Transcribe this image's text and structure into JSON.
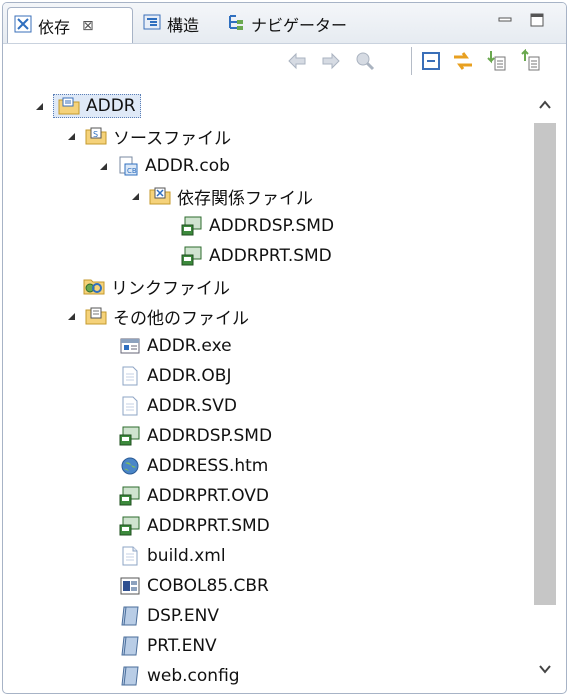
{
  "tabs": [
    {
      "label": "依存",
      "icon": "dependency-view-icon",
      "active": true
    },
    {
      "label": "構造",
      "icon": "structure-view-icon",
      "active": false
    },
    {
      "label": "ナビゲーター",
      "icon": "navigator-view-icon",
      "active": false
    }
  ],
  "close_glyph": "⊠",
  "toolbar": [
    "back-arrow-icon",
    "forward-arrow-icon",
    "up-folder-icon",
    "collapse-all-icon",
    "link-with-editor-icon",
    "dependency-in-icon",
    "dependency-out-icon"
  ],
  "tree": {
    "root": {
      "label": "ADDR"
    },
    "source_files": {
      "label": "ソースファイル"
    },
    "addr_cob": {
      "label": "ADDR.cob"
    },
    "dependency_files": {
      "label": "依存関係ファイル"
    },
    "dep_addrdsp": {
      "label": "ADDRDSP.SMD"
    },
    "dep_addrprt": {
      "label": "ADDRPRT.SMD"
    },
    "link_files": {
      "label": "リンクファイル"
    },
    "other_files": {
      "label": "その他のファイル"
    },
    "others": [
      {
        "label": "ADDR.exe",
        "icon": "executable-icon"
      },
      {
        "label": "ADDR.OBJ",
        "icon": "file-icon"
      },
      {
        "label": "ADDR.SVD",
        "icon": "file-icon"
      },
      {
        "label": "ADDRDSP.SMD",
        "icon": "screen-definition-icon"
      },
      {
        "label": "ADDRESS.htm",
        "icon": "web-page-icon"
      },
      {
        "label": "ADDRPRT.OVD",
        "icon": "screen-definition-icon"
      },
      {
        "label": "ADDRPRT.SMD",
        "icon": "screen-definition-icon"
      },
      {
        "label": "build.xml",
        "icon": "xml-file-icon"
      },
      {
        "label": "COBOL85.CBR",
        "icon": "cobol-config-icon"
      },
      {
        "label": "DSP.ENV",
        "icon": "env-file-icon"
      },
      {
        "label": "PRT.ENV",
        "icon": "env-file-icon"
      },
      {
        "label": "web.config",
        "icon": "env-file-icon"
      }
    ]
  },
  "colors": {
    "accent": "#2f6fbf",
    "folder": "#e8b84a",
    "selection": "#dfe9f7"
  }
}
